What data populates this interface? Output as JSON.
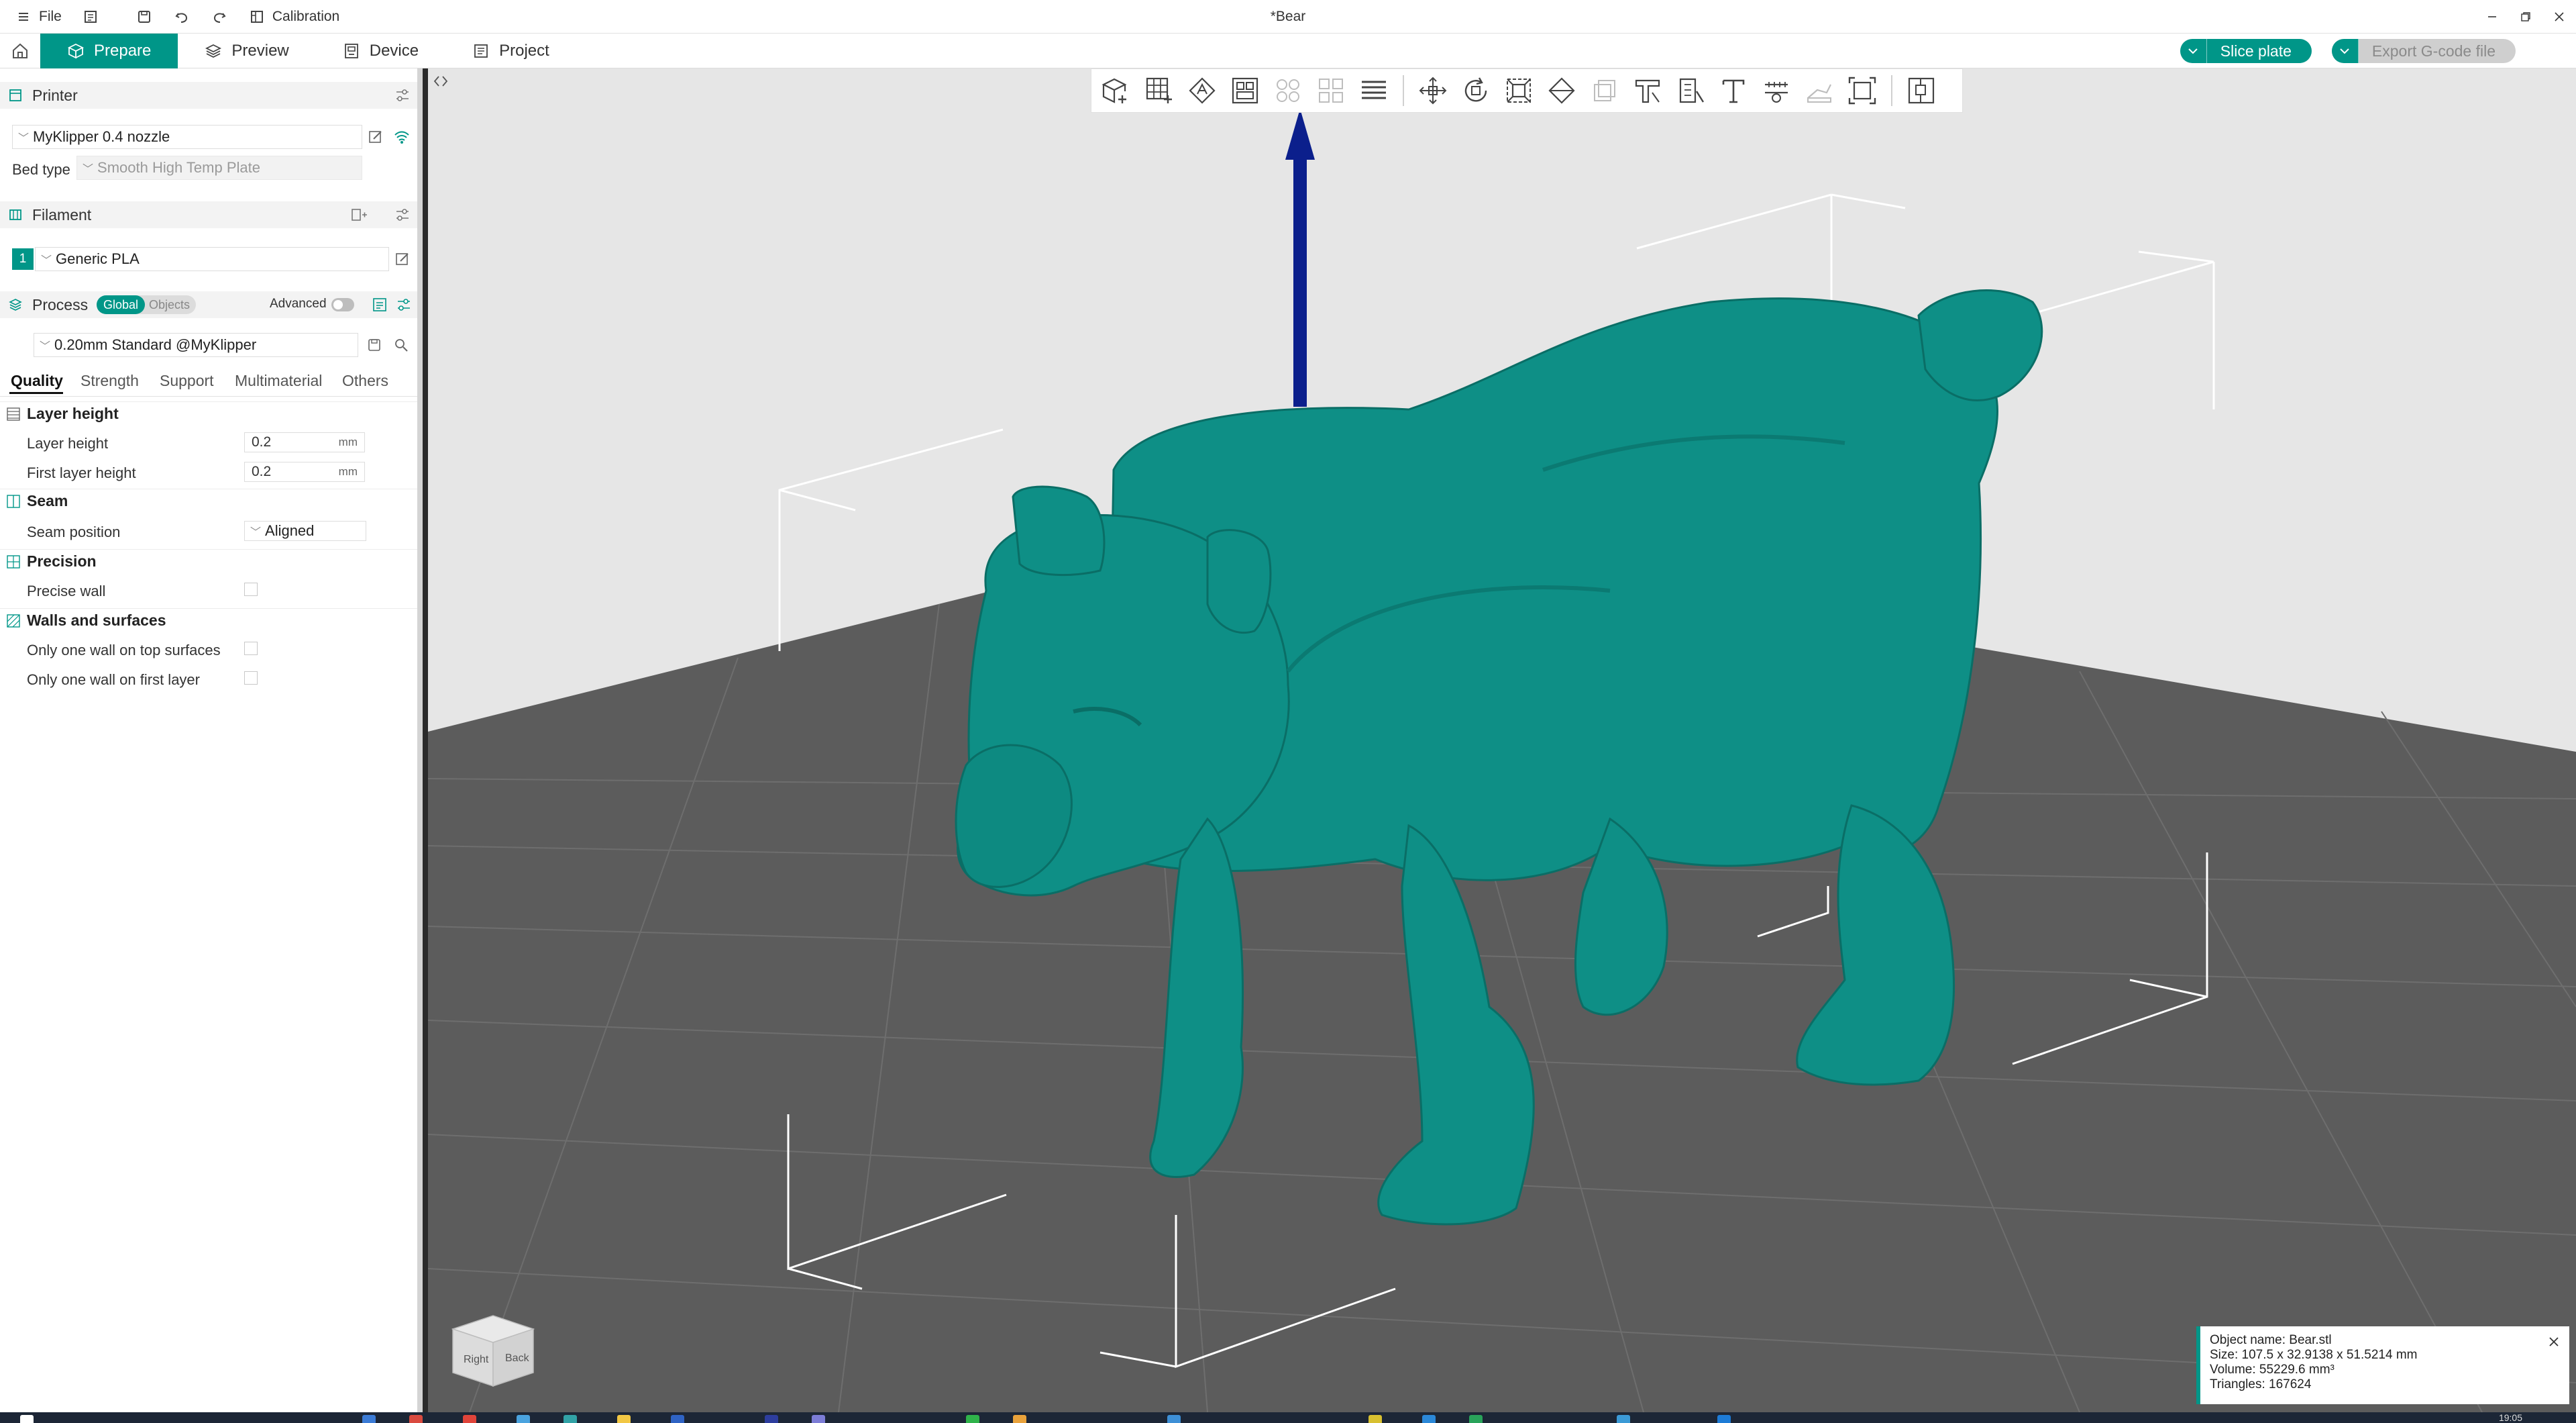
{
  "titlebar": {
    "file_label": "File",
    "calibration_label": "Calibration",
    "window_title": "*Bear"
  },
  "tabs": [
    {
      "label": "Prepare",
      "icon": "cube-icon",
      "active": true
    },
    {
      "label": "Preview",
      "icon": "layers-icon",
      "active": false
    },
    {
      "label": "Device",
      "icon": "device-icon",
      "active": false
    },
    {
      "label": "Project",
      "icon": "project-icon",
      "active": false
    }
  ],
  "actions": {
    "slice_label": "Slice plate",
    "export_label": "Export G-code file"
  },
  "printer": {
    "section_label": "Printer",
    "name": "MyKlipper 0.4 nozzle",
    "bed_type_label": "Bed type",
    "bed_type_value": "Smooth High Temp Plate"
  },
  "filament": {
    "section_label": "Filament",
    "slot_number": "1",
    "name": "Generic PLA",
    "color": "#009688"
  },
  "process": {
    "section_label": "Process",
    "global_label": "Global",
    "objects_label": "Objects",
    "advanced_label": "Advanced",
    "advanced_enabled": false,
    "preset": "0.20mm Standard @MyKlipper",
    "tabs": [
      "Quality",
      "Strength",
      "Support",
      "Multimaterial",
      "Others"
    ],
    "active_tab": "Quality",
    "groups": {
      "layer_height": {
        "title": "Layer height",
        "layer_height_label": "Layer height",
        "layer_height_value": "0.2",
        "first_layer_label": "First layer height",
        "first_layer_value": "0.2",
        "unit": "mm"
      },
      "seam": {
        "title": "Seam",
        "seam_position_label": "Seam position",
        "seam_position_value": "Aligned"
      },
      "precision": {
        "title": "Precision",
        "precise_wall_label": "Precise wall",
        "precise_wall_checked": false
      },
      "walls": {
        "title": "Walls and surfaces",
        "one_wall_top_label": "Only one wall on top surfaces",
        "one_wall_top_checked": false,
        "one_wall_first_label": "Only one wall on first layer",
        "one_wall_first_checked": false
      }
    }
  },
  "object_info": {
    "name_line": "Object name: Bear.stl",
    "size_line": "Size: 107.5 x 32.9138 x 51.5214 mm",
    "volume_line": "Volume: 55229.6 mm³",
    "triangles_line": "Triangles: 167624"
  },
  "navcube": {
    "right_label": "Right",
    "back_label": "Back"
  },
  "taskbar": {
    "time": "19:05"
  },
  "colors": {
    "accent": "#009688",
    "model": "#0e8f86",
    "plate": "#5c5c5c",
    "background": "#e6e6e6"
  }
}
